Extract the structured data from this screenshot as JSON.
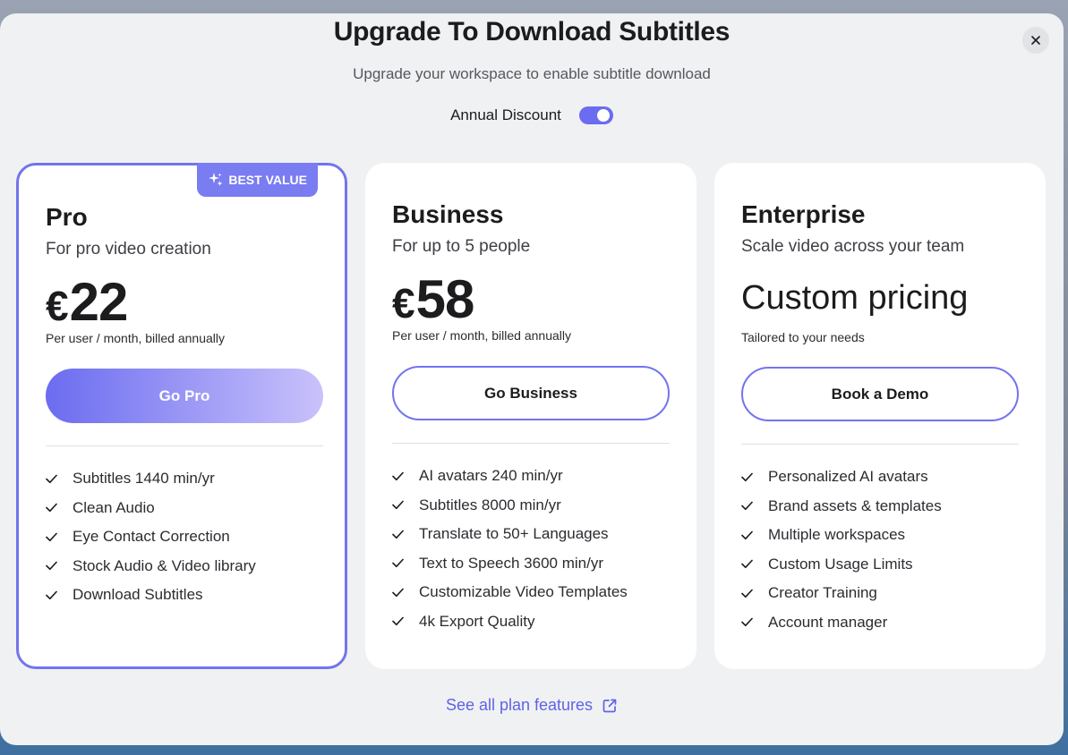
{
  "header": {
    "title": "Upgrade To Download Subtitles",
    "subtitle": "Upgrade your workspace to enable subtitle download",
    "toggle_label": "Annual Discount",
    "toggle_on": true
  },
  "plans": [
    {
      "badge": "BEST VALUE",
      "name": "Pro",
      "description": "For pro video creation",
      "currency": "€",
      "price": "22",
      "billing": "Per user / month, billed annually",
      "cta": "Go Pro",
      "features": [
        "Subtitles 1440 min/yr",
        "Clean Audio",
        "Eye Contact Correction",
        "Stock Audio & Video library",
        "Download Subtitles"
      ]
    },
    {
      "name": "Business",
      "description": "For up to 5 people",
      "currency": "€",
      "price": "58",
      "billing": "Per user / month, billed annually",
      "cta": "Go Business",
      "features": [
        "AI avatars 240 min/yr",
        "Subtitles 8000 min/yr",
        "Translate to 50+ Languages",
        "Text to Speech 3600 min/yr",
        "Customizable Video Templates",
        "4k Export Quality"
      ]
    },
    {
      "name": "Enterprise",
      "description": "Scale video across your team",
      "price_text": "Custom pricing",
      "billing": "Tailored to your needs",
      "cta": "Book a Demo",
      "features": [
        "Personalized AI avatars",
        "Brand assets & templates",
        "Multiple workspaces",
        "Custom Usage Limits",
        "Creator Training",
        "Account manager"
      ]
    }
  ],
  "footer": {
    "see_all": "See all plan features"
  },
  "colors": {
    "accent": "#7274ee",
    "link": "#5f63e6",
    "modal_bg": "#f0f1f3"
  },
  "icons": {
    "close": "close-icon",
    "check": "check-icon",
    "sparkle": "sparkle-icon",
    "external": "external-link-icon"
  }
}
